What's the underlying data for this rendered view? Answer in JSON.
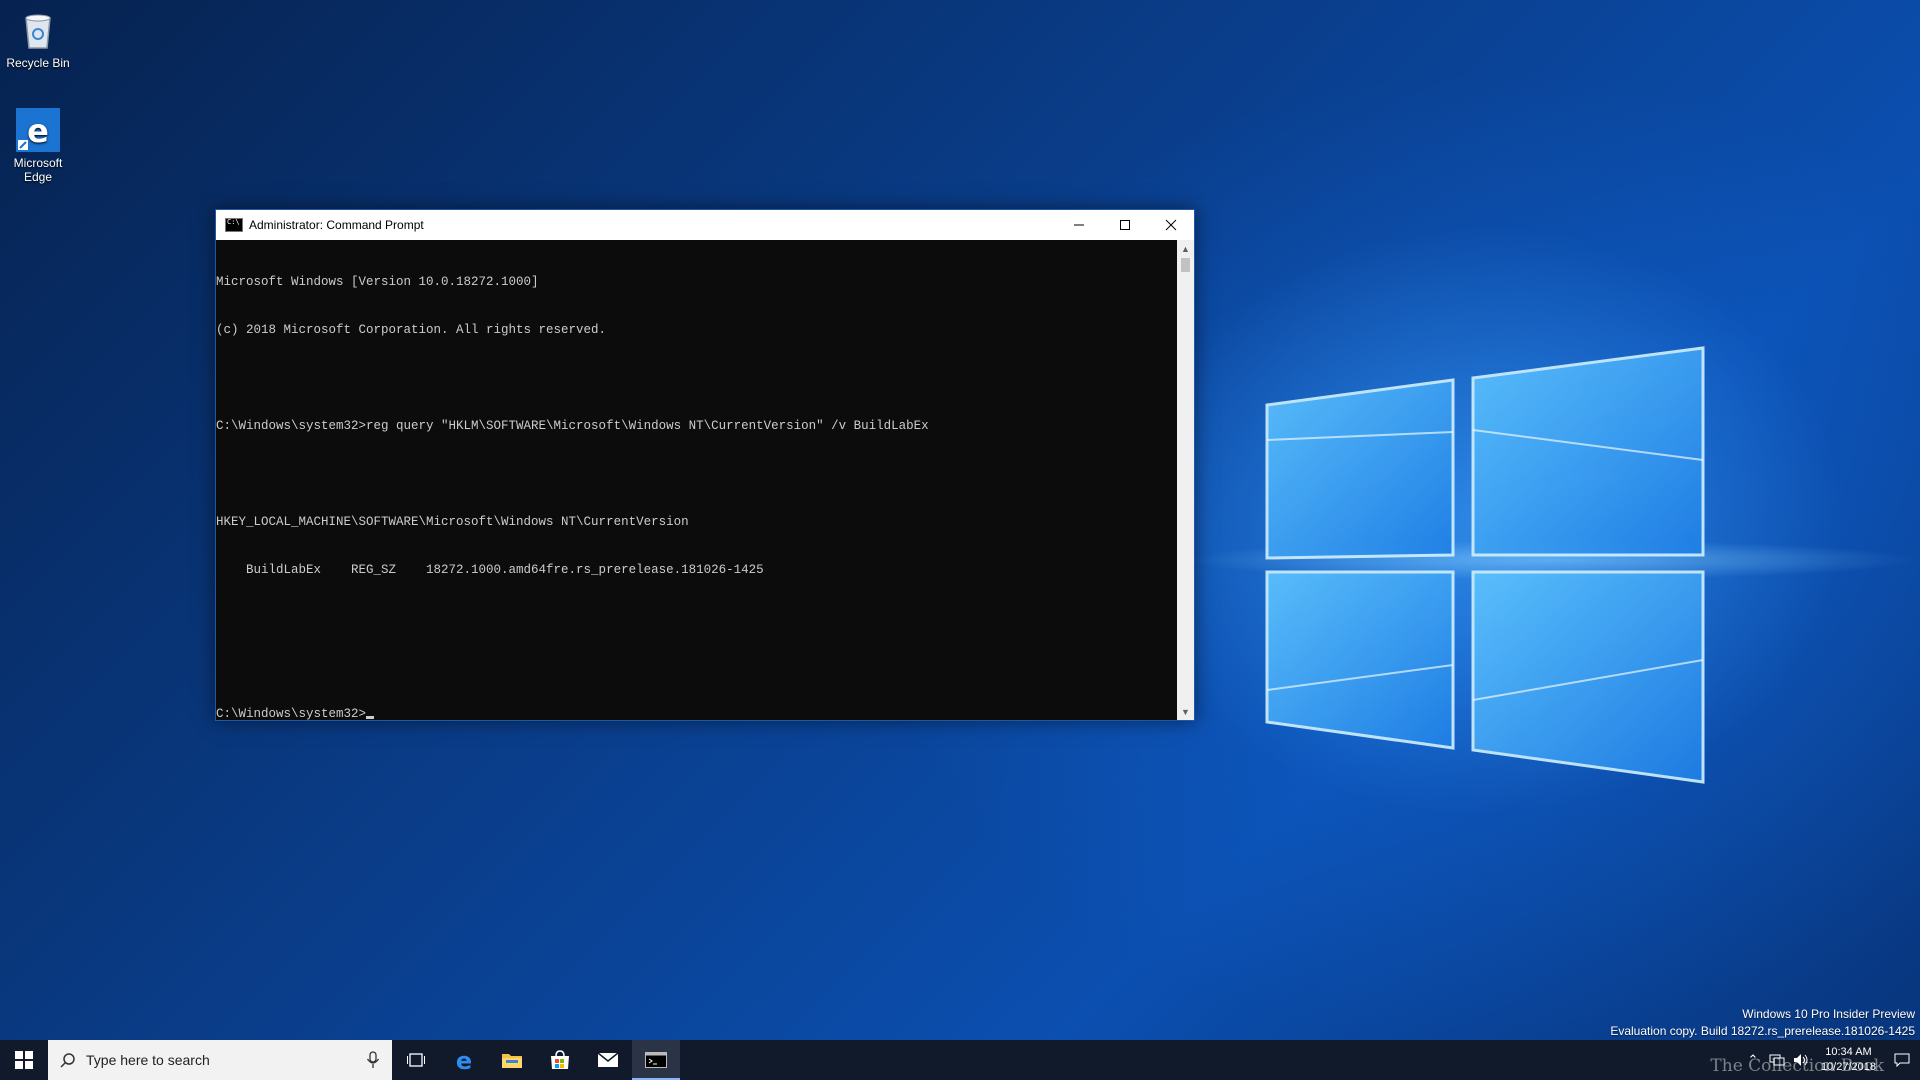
{
  "desktop": {
    "icons": [
      {
        "label": "Recycle Bin"
      },
      {
        "label": "Microsoft Edge"
      }
    ]
  },
  "cmd_window": {
    "title": "Administrator: Command Prompt",
    "lines": [
      "Microsoft Windows [Version 10.0.18272.1000]",
      "(c) 2018 Microsoft Corporation. All rights reserved.",
      "",
      "C:\\Windows\\system32>reg query \"HKLM\\SOFTWARE\\Microsoft\\Windows NT\\CurrentVersion\" /v BuildLabEx",
      "",
      "HKEY_LOCAL_MACHINE\\SOFTWARE\\Microsoft\\Windows NT\\CurrentVersion",
      "    BuildLabEx    REG_SZ    18272.1000.amd64fre.rs_prerelease.181026-1425",
      "",
      ""
    ],
    "prompt": "C:\\Windows\\system32>"
  },
  "watermark": {
    "line1": "Windows 10 Pro Insider Preview",
    "line2": "Evaluation copy. Build 18272.rs_prerelease.181026-1425"
  },
  "taskbar": {
    "search_placeholder": "Type here to search",
    "clock_time": "10:34 AM",
    "clock_date": "10/27/2018",
    "brand_overlay": "The Collection Book"
  },
  "colors": {
    "console_bg": "#0c0c0c",
    "console_text": "#cccccc",
    "taskbar_bg": "#101a2b",
    "accent": "#1c5aa8"
  }
}
